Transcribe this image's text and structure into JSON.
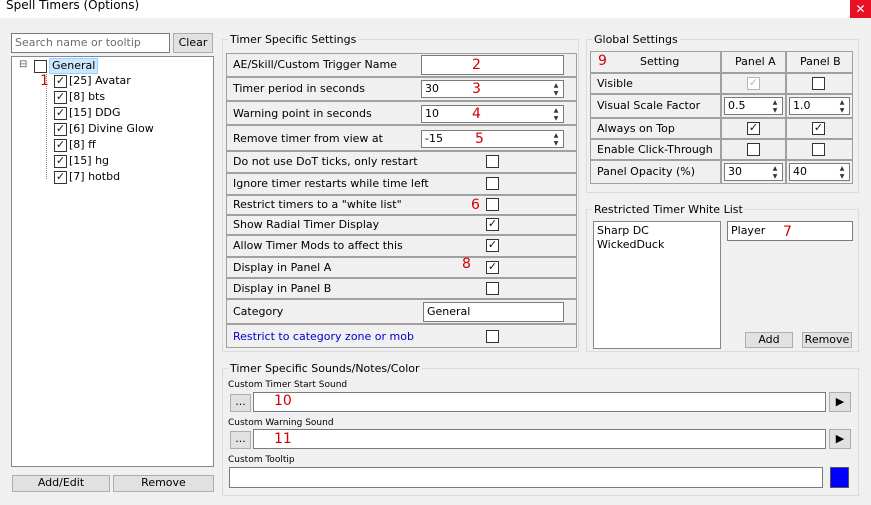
{
  "window": {
    "title": "Spell Timers (Options)",
    "close_glyph": "✕"
  },
  "search": {
    "placeholder": "Search name or tooltip",
    "clear_label": "Clear"
  },
  "tree": {
    "root_label": "General",
    "expander": "⊟",
    "items": [
      "[25] Avatar",
      "[8] bts",
      "[15] DDG",
      "[6] Divine Glow",
      "[8] ff",
      "[15] hg",
      "[7] hotbd"
    ]
  },
  "left_buttons": {
    "add_edit": "Add/Edit",
    "remove": "Remove"
  },
  "timer_settings": {
    "title": "Timer Specific Settings",
    "trigger_label": "AE/Skill/Custom Trigger Name",
    "trigger_value": "",
    "period_label": "Timer period in seconds",
    "period_value": "30",
    "warning_label": "Warning point in seconds",
    "warning_value": "10",
    "remove_label": "Remove timer from view at",
    "remove_value": "-15",
    "checks": [
      {
        "label": "Do not use DoT ticks, only restart",
        "checked": false
      },
      {
        "label": "Ignore timer restarts while time left",
        "checked": false
      },
      {
        "label": "Restrict timers to a \"white list\"",
        "checked": false
      },
      {
        "label": "Show Radial Timer Display",
        "checked": true
      },
      {
        "label": "Allow Timer Mods to affect this",
        "checked": true
      },
      {
        "label": "Display in Panel A",
        "checked": true
      },
      {
        "label": "Display in Panel B",
        "checked": false
      }
    ],
    "category_label": "Category",
    "category_value": "General",
    "restrict_label": "Restrict to category zone or mob",
    "restrict_color": "#0000cc"
  },
  "global": {
    "title": "Global Settings",
    "header": [
      "Setting",
      "Panel A",
      "Panel B"
    ],
    "visible_label": "Visible",
    "visual_scale_label": "Visual Scale Factor",
    "scale_a": "0.5",
    "scale_b": "1.0",
    "always_top_label": "Always on Top",
    "click_through_label": "Enable Click-Through",
    "opacity_label": "Panel Opacity (%)",
    "opacity_a": "30",
    "opacity_b": "40"
  },
  "whitelist": {
    "title": "Restricted Timer White List",
    "items": [
      "Sharp DC",
      "WickedDuck"
    ],
    "input_value": "Player",
    "add": "Add",
    "remove": "Remove"
  },
  "sounds": {
    "title": "Timer Specific Sounds/Notes/Color",
    "start_label": "Custom Timer Start Sound",
    "warning_label": "Custom Warning Sound",
    "tooltip_label": "Custom Tooltip",
    "browse": "...",
    "play_glyph": "▶",
    "color_swatch": "#0000ff"
  },
  "annotations": [
    "1",
    "2",
    "3",
    "4",
    "5",
    "6",
    "7",
    "8",
    "9",
    "10",
    "11"
  ],
  "checkmark": "✓"
}
